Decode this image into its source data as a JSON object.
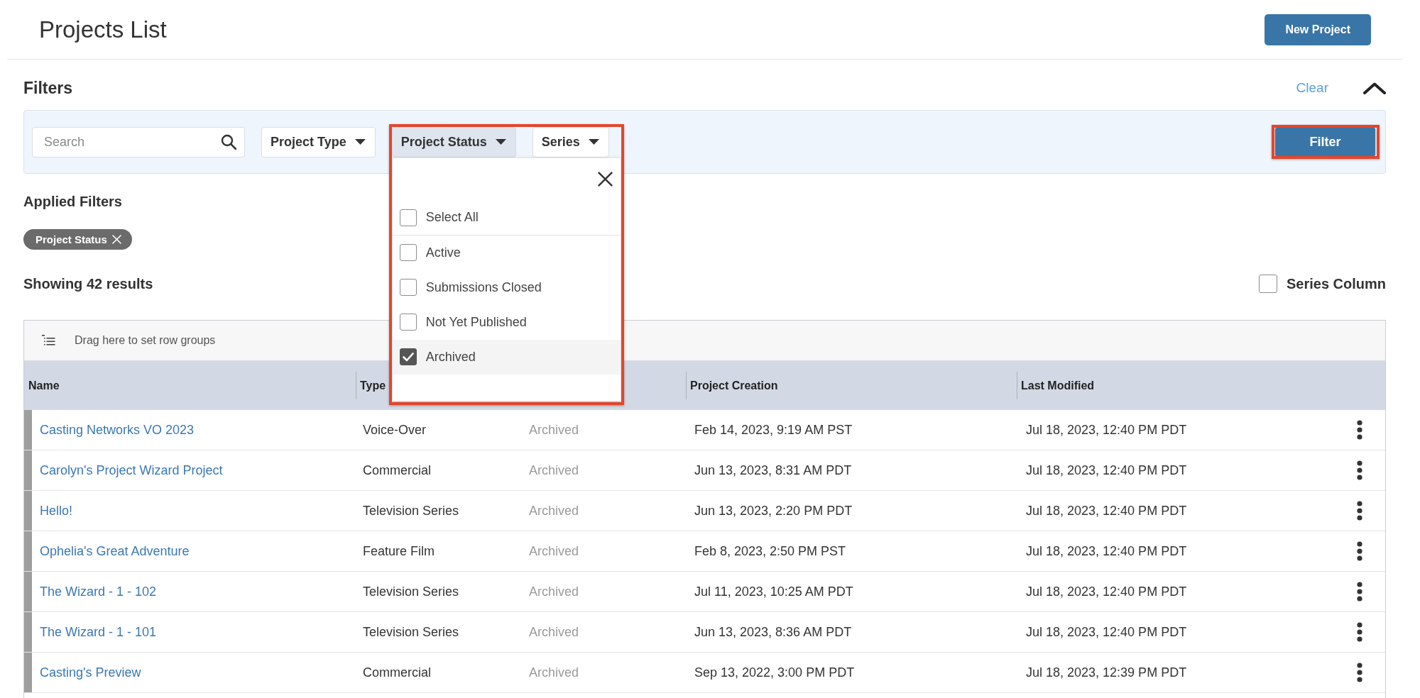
{
  "page": {
    "title": "Projects List",
    "new_project_button": "New Project"
  },
  "filters": {
    "heading": "Filters",
    "clear_link": "Clear",
    "expanded": true,
    "search": {
      "placeholder": "Search"
    },
    "dropdowns": [
      {
        "label": "Project Type",
        "open": false,
        "highlighted": false
      },
      {
        "label": "Project Status",
        "open": true,
        "highlighted": true,
        "menu": {
          "select_all": {
            "label": "Select All",
            "checked": false
          },
          "options": [
            {
              "label": "Active",
              "checked": false
            },
            {
              "label": "Submissions Closed",
              "checked": false
            },
            {
              "label": "Not Yet Published",
              "checked": false
            },
            {
              "label": "Archived",
              "checked": true
            }
          ]
        }
      },
      {
        "label": "Series",
        "open": false,
        "highlighted": false
      }
    ],
    "submit": {
      "label": "Filter",
      "highlighted": true
    }
  },
  "applied_filters": {
    "heading": "Applied Filters",
    "chips": [
      {
        "label": "Project Status"
      }
    ]
  },
  "results": {
    "summary": "Showing 42 results",
    "series_column": {
      "label": "Series Column",
      "checked": false
    }
  },
  "grid": {
    "group_hint": "Drag here to set row groups",
    "columns": {
      "name": "Name",
      "type": "Type",
      "project_creation": "Project Creation",
      "last_modified": "Last Modified"
    },
    "rows": [
      {
        "name": "Casting Networks VO 2023",
        "type": "Voice-Over",
        "column_3": "Archived",
        "project_creation": "Feb 14, 2023, 9:19 AM PST",
        "last_modified": "Jul 18, 2023, 12:40 PM PDT"
      },
      {
        "name": "Carolyn's Project Wizard Project",
        "type": "Commercial",
        "column_3": "Archived",
        "project_creation": "Jun 13, 2023, 8:31 AM PDT",
        "last_modified": "Jul 18, 2023, 12:40 PM PDT"
      },
      {
        "name": "Hello!",
        "type": "Television Series",
        "column_3": "Archived",
        "project_creation": "Jun 13, 2023, 2:20 PM PDT",
        "last_modified": "Jul 18, 2023, 12:40 PM PDT"
      },
      {
        "name": "Ophelia's Great Adventure",
        "type": "Feature Film",
        "column_3": "Archived",
        "project_creation": "Feb 8, 2023, 2:50 PM PST",
        "last_modified": "Jul 18, 2023, 12:40 PM PDT"
      },
      {
        "name": "The Wizard - 1 - 102",
        "type": "Television Series",
        "column_3": "Archived",
        "project_creation": "Jul 11, 2023, 10:25 AM PDT",
        "last_modified": "Jul 18, 2023, 12:40 PM PDT"
      },
      {
        "name": "The Wizard - 1 - 101",
        "type": "Television Series",
        "column_3": "Archived",
        "project_creation": "Jun 13, 2023, 8:36 AM PDT",
        "last_modified": "Jul 18, 2023, 12:40 PM PDT"
      },
      {
        "name": "Casting's Preview",
        "type": "Commercial",
        "column_3": "Archived",
        "project_creation": "Sep 13, 2022, 3:00 PM PDT",
        "last_modified": "Jul 18, 2023, 12:39 PM PDT"
      }
    ]
  }
}
